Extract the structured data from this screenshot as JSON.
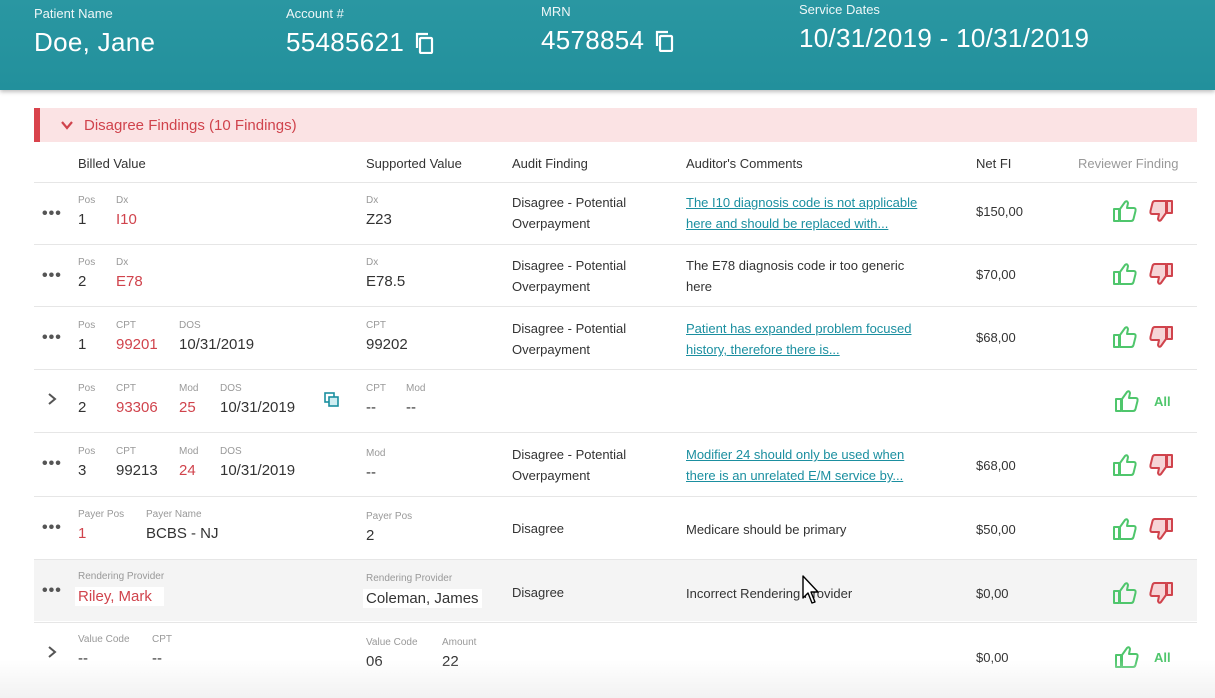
{
  "header": {
    "patient_label": "Patient Name",
    "patient_value": "Doe, Jane",
    "account_label": "Account #",
    "account_value": "55485621",
    "mrn_label": "MRN",
    "mrn_value": "4578854",
    "dates_label": "Service Dates",
    "dates_value": "10/31/2019 - 10/31/2019"
  },
  "section": {
    "title": "Disagree Findings (10 Findings)"
  },
  "columns": {
    "billed": "Billed Value",
    "supported": "Supported Value",
    "audit": "Audit Finding",
    "comments": "Auditor's Comments",
    "netfi": "Net FI",
    "reviewer": "Reviewer Finding"
  },
  "rows": [
    {
      "b1_label": "Pos",
      "b1_value": "1",
      "b2_label": "Dx",
      "b2_value": "I10",
      "s1_label": "Dx",
      "s1_value": "Z23",
      "finding_1": "Disagree - Potential",
      "finding_2": "Overpayment",
      "comment_1": "The I10 diagnosis code is not applicable",
      "comment_2": "here and should be replaced with...",
      "netfi": "$150,00"
    },
    {
      "b1_label": "Pos",
      "b1_value": "2",
      "b2_label": "Dx",
      "b2_value": "E78",
      "s1_label": "Dx",
      "s1_value": "E78.5",
      "finding_1": "Disagree - Potential",
      "finding_2": "Overpayment",
      "comment_1": "The E78 diagnosis code ir too generic",
      "comment_2": "here",
      "netfi": "$70,00"
    },
    {
      "b1_label": "Pos",
      "b1_value": "1",
      "b2_label": "CPT",
      "b2_value": "99201",
      "b3_label": "DOS",
      "b3_value": "10/31/2019",
      "s1_label": "CPT",
      "s1_value": "99202",
      "finding_1": "Disagree - Potential",
      "finding_2": "Overpayment",
      "comment_1": "Patient has expanded problem focused",
      "comment_2": "history, therefore there is...",
      "netfi": "$68,00"
    },
    {
      "b1_label": "Pos",
      "b1_value": "2",
      "b2_label": "CPT",
      "b2_value": "93306",
      "b3_label": "Mod",
      "b3_value": "25",
      "b4_label": "DOS",
      "b4_value": "10/31/2019",
      "s1_label": "CPT",
      "s1_value": "--",
      "s2_label": "Mod",
      "s2_value": "--",
      "all_label": "All"
    },
    {
      "b1_label": "Pos",
      "b1_value": "3",
      "b2_label": "CPT",
      "b2_value": "99213",
      "b3_label": "Mod",
      "b3_value": "24",
      "b4_label": "DOS",
      "b4_value": "10/31/2019",
      "s1_label": "Mod",
      "s1_value": "--",
      "finding_1": "Disagree - Potential",
      "finding_2": "Overpayment",
      "comment_1": "Modifier 24 should only be used when",
      "comment_2": "there is an unrelated E/M service by...",
      "netfi": "$68,00"
    },
    {
      "b1_label": "Payer Pos",
      "b1_value": "1",
      "b2_label": "Payer Name",
      "b2_value": "BCBS - NJ",
      "s1_label": "Payer Pos",
      "s1_value": "2",
      "finding_1": "Disagree",
      "comment_1": "Medicare should be primary",
      "netfi": "$50,00"
    },
    {
      "b1_label": "Rendering Provider",
      "b1_value": "Riley, Mark",
      "s1_label": "Rendering Provider",
      "s1_value": "Coleman, James",
      "finding_1": "Disagree",
      "comment_1": "Incorrect Rendering Provider",
      "netfi": "$0,00"
    },
    {
      "b1_label": "Value Code",
      "b1_value": "--",
      "b2_label": "CPT",
      "b2_value": "--",
      "s1_label": "Value Code",
      "s1_value": "06",
      "s2_label": "Amount",
      "s2_value": "22",
      "netfi": "$0,00",
      "all_label": "All"
    }
  ],
  "colors": {
    "teal": "#2a97a2",
    "red": "#d0434c",
    "green": "#4fc66c",
    "link": "#1b8fa0"
  }
}
